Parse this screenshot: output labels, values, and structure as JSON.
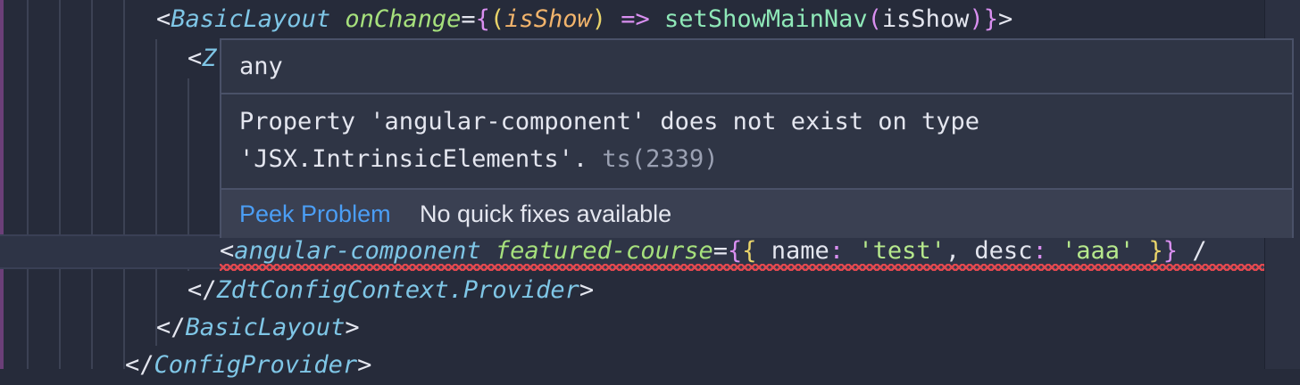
{
  "code": {
    "line1": {
      "open_bracket": "<",
      "tag": "BasicLayout",
      "attr": "onChange",
      "eq": "=",
      "brace_open": "{",
      "paren_open": "(",
      "param": "isShow",
      "paren_close": ")",
      "arrow": "=>",
      "fn": "setShowMainNav",
      "call_open": "(",
      "arg": "isShow",
      "call_close": ")",
      "brace_close": "}",
      "close_bracket": ">"
    },
    "line2": {
      "open_bracket": "<",
      "tag_partial": "Z"
    },
    "line6": {
      "open_bracket": "<",
      "tag": "angular-component",
      "attr": "featured-course",
      "eq": "=",
      "outer_open": "{",
      "inner_open": "{",
      "key1": "name",
      "colon1": ":",
      "val1": "'test'",
      "comma": ",",
      "key2": "desc",
      "colon2": ":",
      "val2": "'aaa'",
      "inner_close": "}",
      "outer_close": "}",
      "tail": "/"
    },
    "line7": {
      "open": "</",
      "tag": "ZdtConfigContext.Provider",
      "close": ">"
    },
    "line8": {
      "open": "</",
      "tag": "BasicLayout",
      "close": ">"
    },
    "line9": {
      "open": "</",
      "tag": "ConfigProvider",
      "close": ">"
    }
  },
  "hover": {
    "type_text": "any",
    "message_line1": "Property 'angular-component' does not exist on type",
    "message_line2": "'JSX.IntrinsicElements'.",
    "ts_code": "ts(2339)",
    "peek_label": "Peek Problem",
    "no_fixes_label": "No quick fixes available"
  },
  "colors": {
    "background": "#262b3a",
    "tag": "#7fc6e6",
    "attribute": "#a6e07c",
    "string": "#b6e88c",
    "link": "#4b9ef5",
    "error_squiggle": "#e0484f"
  }
}
